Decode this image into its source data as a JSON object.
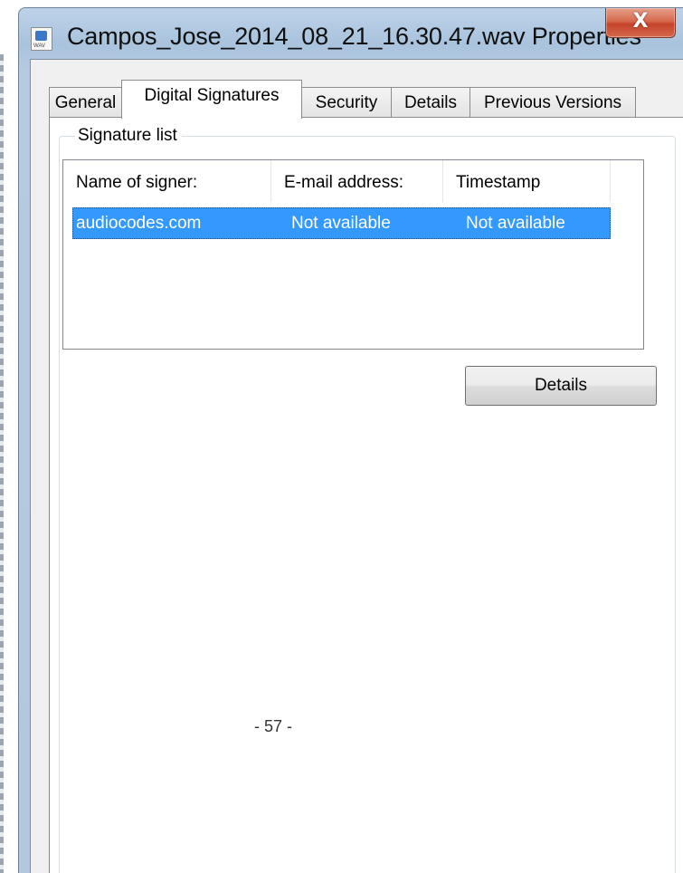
{
  "window": {
    "title": "Campos_Jose_2014_08_21_16.30.47.wav Properties",
    "close_label": "X",
    "icon_text": "WAV"
  },
  "tabs": [
    {
      "label": "General"
    },
    {
      "label": "Digital Signatures",
      "active": true
    },
    {
      "label": "Security"
    },
    {
      "label": "Details"
    },
    {
      "label": "Previous Versions"
    }
  ],
  "signature_group": {
    "label": "Signature list",
    "columns": [
      "Name of signer:",
      "E-mail address:",
      "Timestamp"
    ],
    "rows": [
      {
        "name": "audiocodes.com",
        "email": "Not available",
        "timestamp": "Not available",
        "selected": true
      }
    ]
  },
  "buttons": {
    "details_label": "Details"
  },
  "footer": {
    "page_number": "- 57 -"
  },
  "colors": {
    "selection": "#3399ff",
    "close_button": "#c4432a",
    "title_bar": "#b2c8de"
  }
}
